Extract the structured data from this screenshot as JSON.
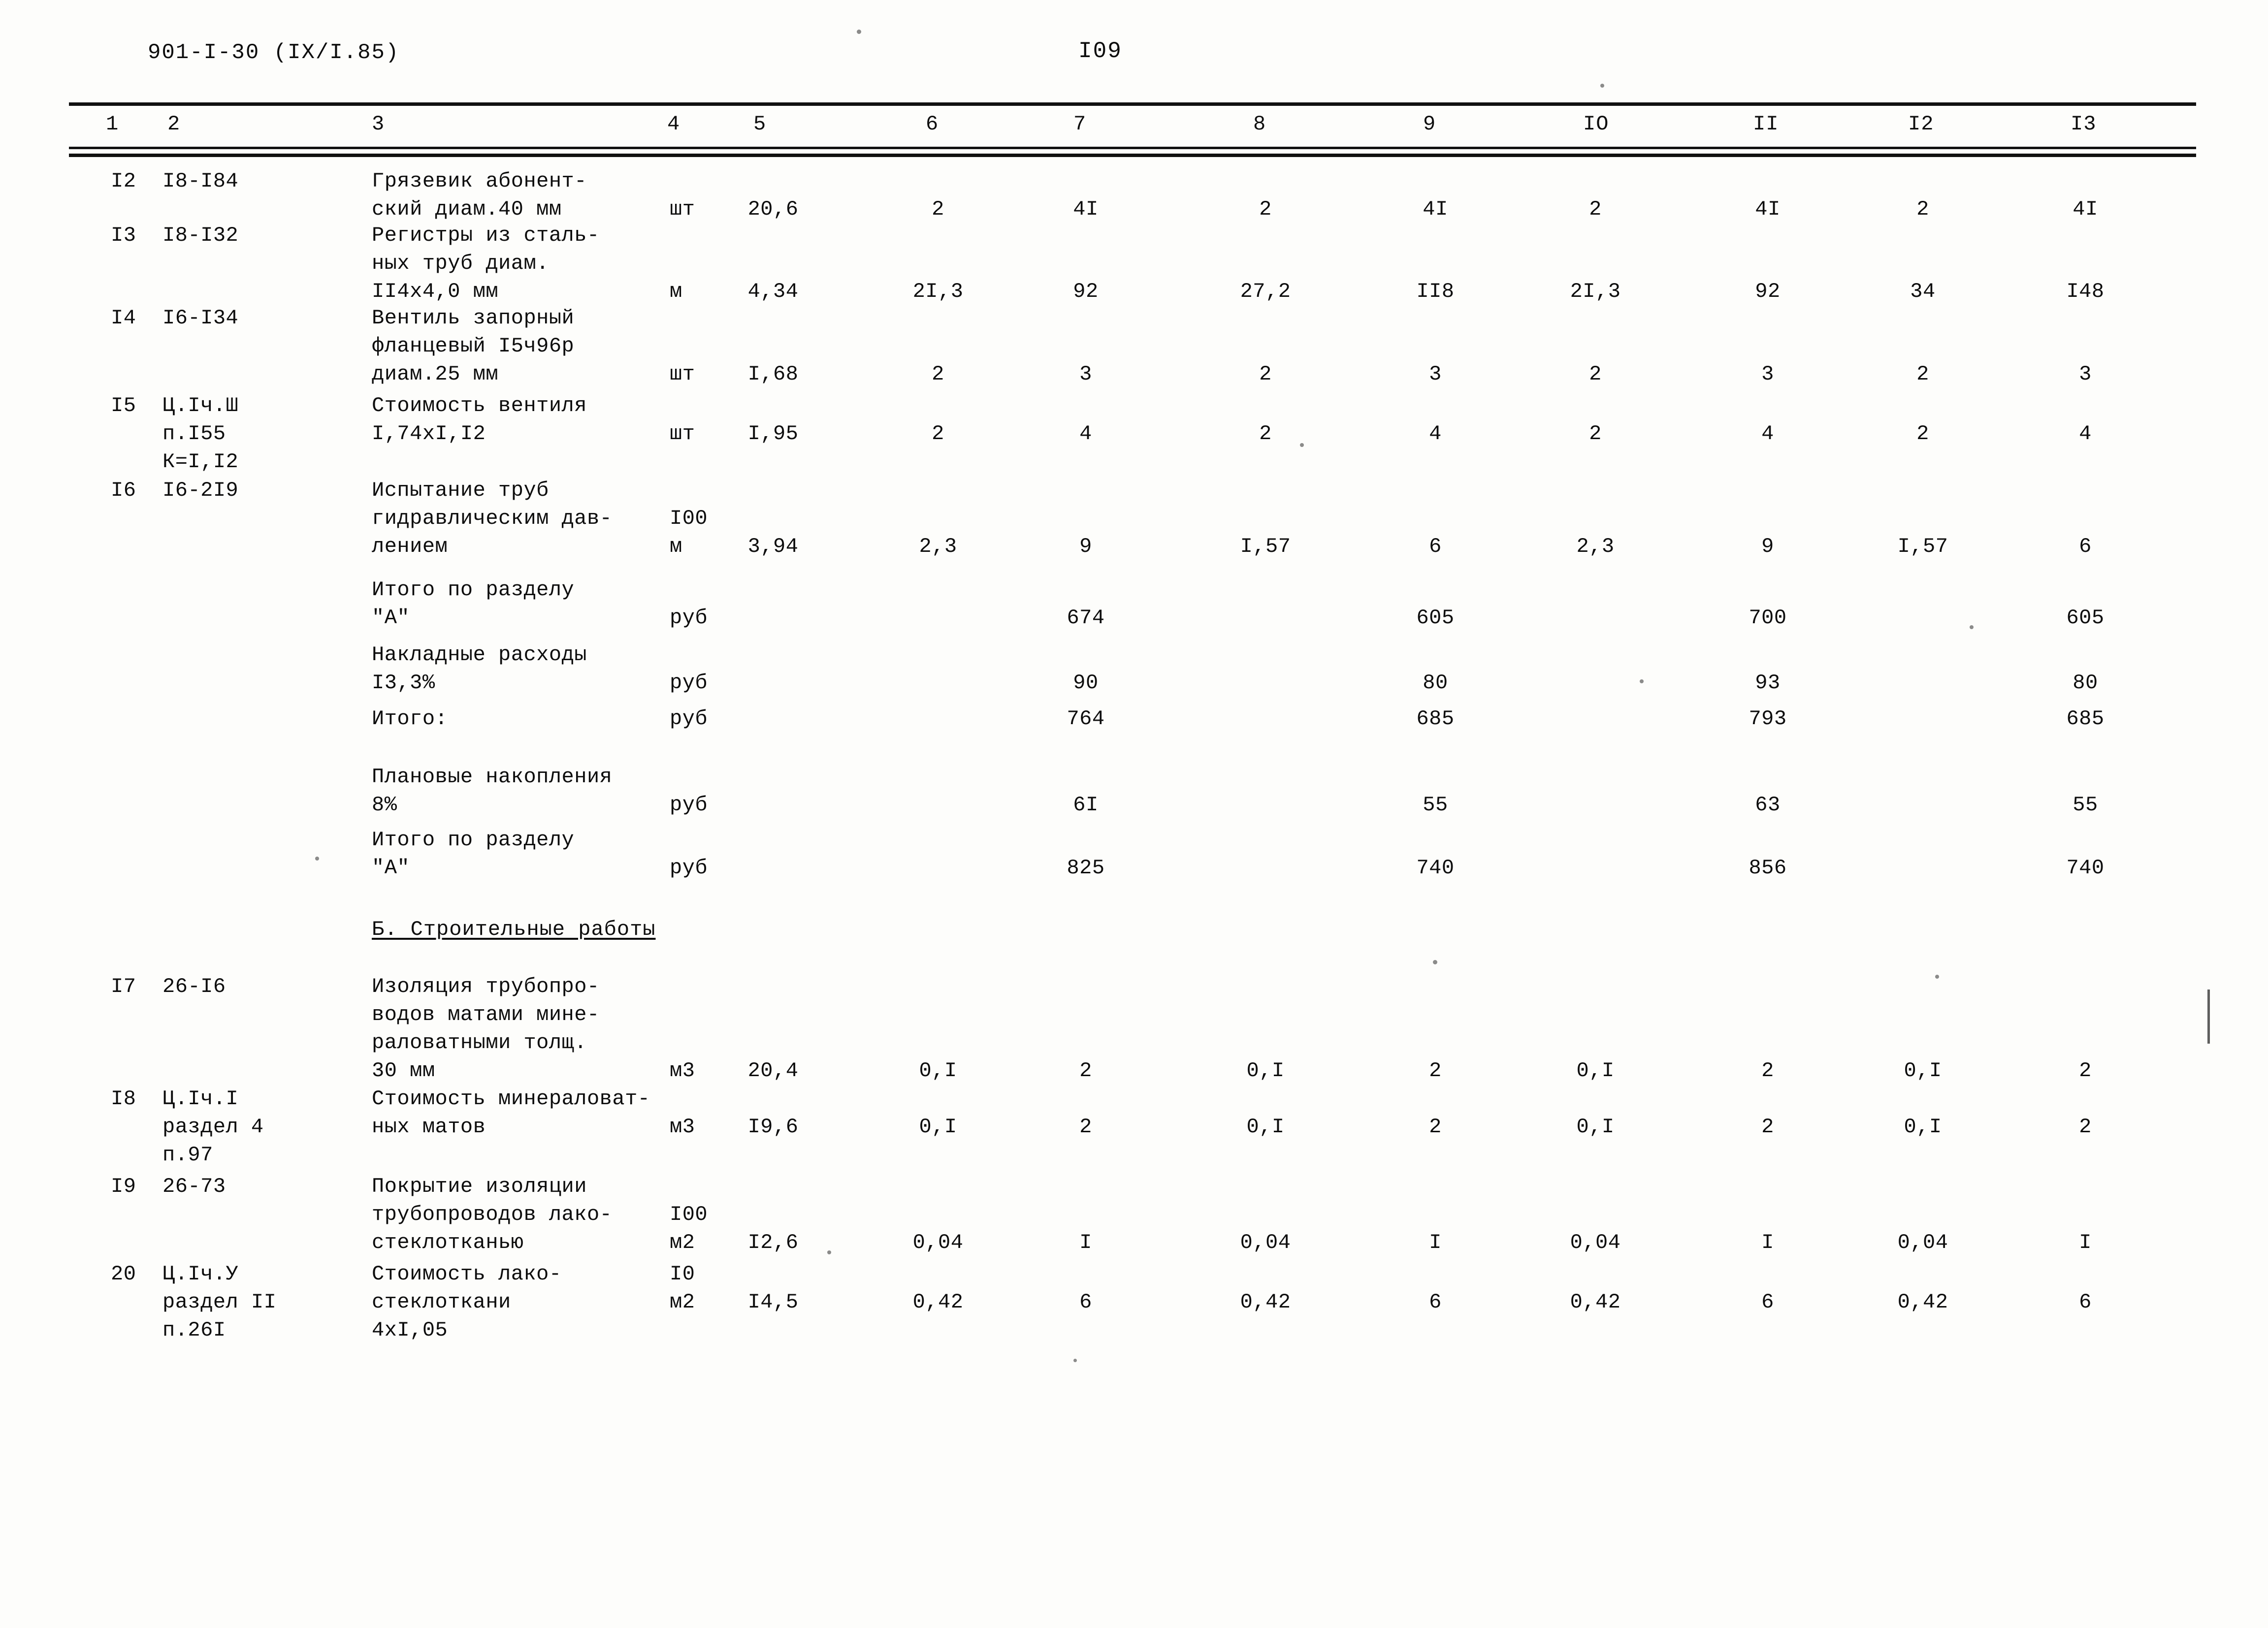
{
  "header": {
    "doc_code": "901-I-30 (IХ/I.85)",
    "page_number": "I09"
  },
  "table": {
    "column_numbers": [
      "1",
      "2",
      "3",
      "4",
      "5",
      "6",
      "7",
      "8",
      "9",
      "IO",
      "II",
      "I2",
      "I3"
    ],
    "rows": [
      {
        "num": "I2",
        "code": "I8-I84",
        "desc": "Грязевик абонент-\nский диам.40 мм",
        "unit": "шт",
        "c5": "20,6",
        "c6": "2",
        "c7": "4I",
        "c8": "2",
        "c9": "4I",
        "c10": "2",
        "c11": "4I",
        "c12": "2",
        "c13": "4I"
      },
      {
        "num": "I3",
        "code": "I8-I32",
        "desc": "Регистры из сталь-\nных труб диам.\nII4х4,0 мм",
        "unit": "м",
        "c5": "4,34",
        "c6": "2I,3",
        "c7": "92",
        "c8": "27,2",
        "c9": "II8",
        "c10": "2I,3",
        "c11": "92",
        "c12": "34",
        "c13": "I48"
      },
      {
        "num": "I4",
        "code": "I6-I34",
        "desc": "Вентиль запорный\nфланцевый I5ч96р\nдиам.25 мм",
        "unit": "шт",
        "c5": "I,68",
        "c6": "2",
        "c7": "3",
        "c8": "2",
        "c9": "3",
        "c10": "2",
        "c11": "3",
        "c12": "2",
        "c13": "3"
      },
      {
        "num": "I5",
        "code": "Ц.Iч.Ш\nп.I55\nК=I,I2",
        "desc": "Стоимость вентиля\nI,74хI,I2",
        "unit": "шт",
        "c5": "I,95",
        "c6": "2",
        "c7": "4",
        "c8": "2",
        "c9": "4",
        "c10": "2",
        "c11": "4",
        "c12": "2",
        "c13": "4"
      },
      {
        "num": "I6",
        "code": "I6-2I9",
        "desc": "Испытание труб\nгидравлическим дав-\nлением",
        "unit": "I00\nм",
        "c5": "3,94",
        "c6": "2,3",
        "c7": "9",
        "c8": "I,57",
        "c9": "6",
        "c10": "2,3",
        "c11": "9",
        "c12": "I,57",
        "c13": "6"
      }
    ],
    "summary_a": [
      {
        "desc": "Итого по разделу\n\"А\"",
        "unit": "руб",
        "c7": "674",
        "c9": "605",
        "c11": "700",
        "c13": "605"
      },
      {
        "desc": "Накладные расходы\nI3,3%",
        "unit": "руб",
        "c7": "90",
        "c9": "80",
        "c11": "93",
        "c13": "80"
      },
      {
        "desc": "Итого:",
        "unit": "руб",
        "c7": "764",
        "c9": "685",
        "c11": "793",
        "c13": "685"
      },
      {
        "desc": "Плановые накопления\n8%",
        "unit": "руб",
        "c7": "6I",
        "c9": "55",
        "c11": "63",
        "c13": "55"
      },
      {
        "desc": "Итого по разделу\n\"А\"",
        "unit": "руб",
        "c7": "825",
        "c9": "740",
        "c11": "856",
        "c13": "740"
      }
    ],
    "section_b_title": "Б. Строительные работы",
    "rows_b": [
      {
        "num": "I7",
        "code": "26-I6",
        "desc": "Изоляция трубопро-\nводов матами мине-\nраловатными толщ.\n30 мм",
        "unit": "м3",
        "c5": "20,4",
        "c6": "0,I",
        "c7": "2",
        "c8": "0,I",
        "c9": "2",
        "c10": "0,I",
        "c11": "2",
        "c12": "0,I",
        "c13": "2"
      },
      {
        "num": "I8",
        "code": "Ц.Iч.I\nраздел 4\nп.97",
        "desc": "Стоимость минераловат-\nных матов",
        "unit": "м3",
        "c5": "I9,6",
        "c6": "0,I",
        "c7": "2",
        "c8": "0,I",
        "c9": "2",
        "c10": "0,I",
        "c11": "2",
        "c12": "0,I",
        "c13": "2"
      },
      {
        "num": "I9",
        "code": "26-73",
        "desc": "Покрытие изоляции\nтрубопроводов лако-\nстеклотканью",
        "unit": "I00\nм2",
        "c5": "I2,6",
        "c6": "0,04",
        "c7": "I",
        "c8": "0,04",
        "c9": "I",
        "c10": "0,04",
        "c11": "I",
        "c12": "0,04",
        "c13": "I"
      },
      {
        "num": "20",
        "code": "Ц.Iч.У\nраздел II\nп.26I",
        "desc": "Стоимость лако-\nстеклоткани\n4хI,05",
        "unit": "I0\nм2",
        "c5": "I4,5",
        "c6": "0,42",
        "c7": "6",
        "c8": "0,42",
        "c9": "6",
        "c10": "0,42",
        "c11": "6",
        "c12": "0,42",
        "c13": "6"
      }
    ]
  }
}
